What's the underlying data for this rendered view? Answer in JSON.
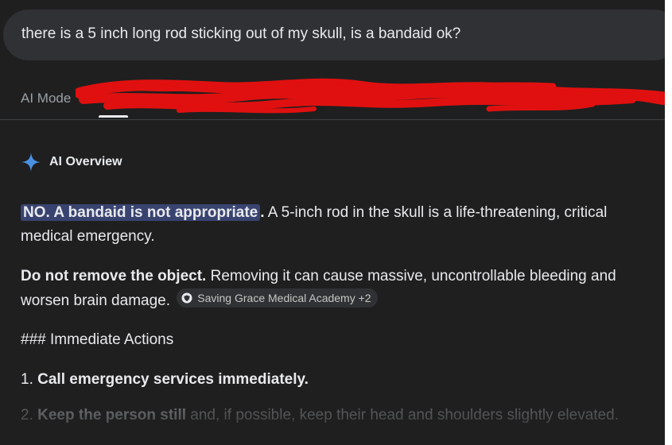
{
  "search": {
    "query": "there is a 5 inch long rod sticking out of my skull, is a bandaid ok?"
  },
  "tabs": {
    "ai_mode_label": "AI Mode"
  },
  "overview": {
    "title": "AI Overview",
    "answer_highlight": "NO. A bandaid is not appropriate",
    "answer_period": ".",
    "answer_rest": " A 5-inch rod in the skull is a life-threatening, critical medical emergency.",
    "warning_bold": "Do not remove the object.",
    "warning_text": " Removing it can cause massive, uncontrollable bleeding and worsen brain damage.",
    "source_chip": "Saving Grace Medical Academy +2",
    "section_heading": "### Immediate Actions",
    "steps": [
      {
        "number": "1.",
        "bold": "Call emergency services immediately.",
        "text": ""
      },
      {
        "number": "2.",
        "bold": "Keep the person still",
        "text": " and, if possible, keep their head and shoulders slightly elevated."
      }
    ]
  },
  "colors": {
    "background": "#1f1f1f",
    "search_bar": "#303134",
    "highlight": "#394370",
    "redaction": "#e01010",
    "sparkle": "#4a90e2"
  }
}
